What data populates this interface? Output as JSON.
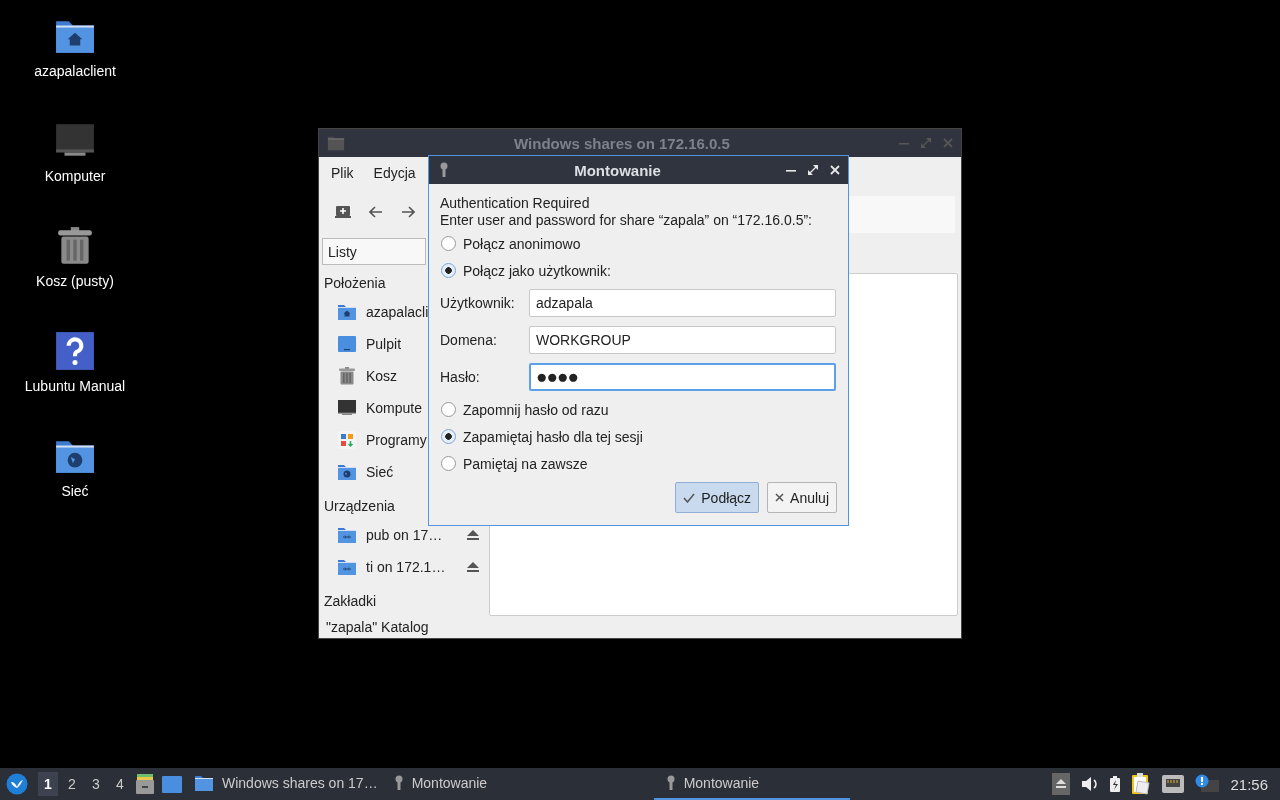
{
  "desktop_icons": [
    {
      "label": "azapalaclient",
      "kind": "home"
    },
    {
      "label": "Komputer",
      "kind": "computer"
    },
    {
      "label": "Kosz (pusty)",
      "kind": "trash"
    },
    {
      "label": "Lubuntu Manual",
      "kind": "help"
    },
    {
      "label": "Sieć",
      "kind": "network"
    }
  ],
  "file_manager": {
    "title": "Windows shares on 172.16.0.5",
    "menu": [
      "Plik",
      "Edycja"
    ],
    "view_mode": "Listy",
    "sidebar": [
      {
        "title": "Położenia",
        "items": [
          {
            "label": "azapalacli",
            "kind": "home"
          },
          {
            "label": "Pulpit",
            "kind": "desktop"
          },
          {
            "label": "Kosz",
            "kind": "trash"
          },
          {
            "label": "Kompute",
            "kind": "computer"
          },
          {
            "label": "Programy",
            "kind": "apps"
          },
          {
            "label": "Sieć",
            "kind": "network"
          }
        ]
      },
      {
        "title": "Urządzenia",
        "items": [
          {
            "label": "pub on 17…",
            "kind": "share",
            "eject": true
          },
          {
            "label": "ti on 172.1…",
            "kind": "share",
            "eject": true
          }
        ]
      },
      {
        "title": "Zakładki"
      }
    ],
    "status_bar": "\"zapala\" Katalog"
  },
  "dialog": {
    "title": "Montowanie",
    "heading": "Authentication Required",
    "message": "Enter user and password for share “zapala” on “172.16.0.5”:",
    "connect_options": [
      {
        "label": "Połącz anonimowo",
        "selected": false
      },
      {
        "label": "Połącz jako użytkownik:",
        "selected": true
      }
    ],
    "fields": [
      {
        "label": "Użytkownik:",
        "value": "adzapala",
        "focused": false
      },
      {
        "label": "Domena:",
        "value": "WORKGROUP",
        "focused": false
      },
      {
        "label": "Hasło:",
        "value": "●●●●",
        "focused": true
      }
    ],
    "password_options": [
      {
        "label": "Zapomnij hasło od razu",
        "selected": false
      },
      {
        "label": "Zapamiętaj hasło dla tej sesji",
        "selected": true
      },
      {
        "label": "Pamiętaj na zawsze",
        "selected": false
      }
    ],
    "buttons": [
      {
        "label": "Podłącz",
        "kind": "confirm",
        "default": true
      },
      {
        "label": "Anuluj",
        "kind": "cancel",
        "default": false
      }
    ]
  },
  "taskbar": {
    "workspaces": [
      {
        "label": "1",
        "selected": true
      },
      {
        "label": "2",
        "selected": false
      },
      {
        "label": "3",
        "selected": false
      },
      {
        "label": "4",
        "selected": false
      }
    ],
    "tasks": [
      {
        "label": "Windows shares on 17…",
        "kind": "folder",
        "selected": false
      },
      {
        "label": "Montowanie",
        "kind": "key",
        "selected": false
      },
      {
        "label": "Montowanie",
        "kind": "key",
        "selected": true
      }
    ],
    "clock": "21:56"
  }
}
